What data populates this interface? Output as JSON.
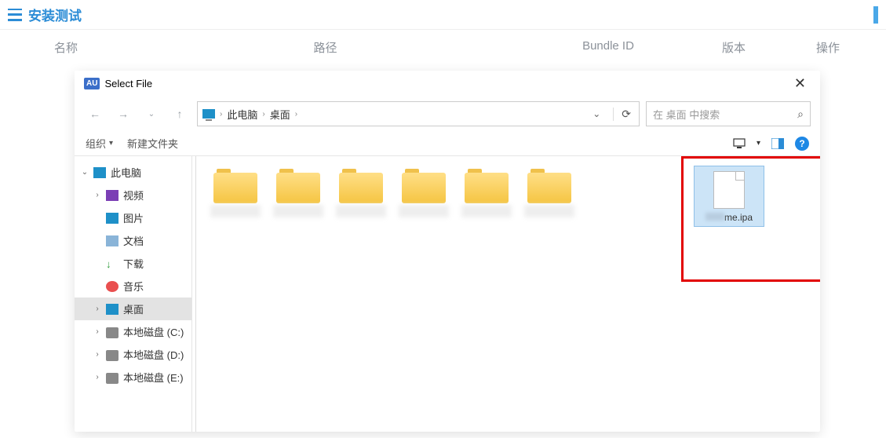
{
  "app": {
    "title": "安装测试"
  },
  "columns": {
    "name": "名称",
    "path": "路径",
    "bundle": "Bundle ID",
    "version": "版本",
    "action": "操作"
  },
  "dialog": {
    "badge": "AU",
    "title": "Select File",
    "breadcrumb": {
      "root": "此电脑",
      "leaf": "桌面"
    },
    "search_placeholder": "在 桌面 中搜索",
    "toolbar": {
      "organize": "组织",
      "new_folder": "新建文件夹"
    },
    "tree": [
      {
        "label": "此电脑",
        "expander": "⌄",
        "icon": "ico-pc",
        "indent": false,
        "sel": false
      },
      {
        "label": "视频",
        "expander": "›",
        "icon": "ico-vid",
        "indent": true,
        "sel": false
      },
      {
        "label": "图片",
        "expander": "",
        "icon": "ico-img",
        "indent": true,
        "sel": false
      },
      {
        "label": "文档",
        "expander": "",
        "icon": "ico-doc",
        "indent": true,
        "sel": false
      },
      {
        "label": "下载",
        "expander": "",
        "icon": "ico-dl",
        "indent": true,
        "sel": false
      },
      {
        "label": "音乐",
        "expander": "",
        "icon": "ico-music",
        "indent": true,
        "sel": false
      },
      {
        "label": "桌面",
        "expander": "›",
        "icon": "ico-desk",
        "indent": true,
        "sel": true
      },
      {
        "label": "本地磁盘 (C:)",
        "expander": "›",
        "icon": "ico-disk",
        "indent": true,
        "sel": false
      },
      {
        "label": "本地磁盘 (D:)",
        "expander": "›",
        "icon": "ico-disk",
        "indent": true,
        "sel": false
      },
      {
        "label": "本地磁盘 (E:)",
        "expander": "›",
        "icon": "ico-disk",
        "indent": true,
        "sel": false
      }
    ],
    "file": {
      "name_suffix": "me.ipa"
    }
  }
}
